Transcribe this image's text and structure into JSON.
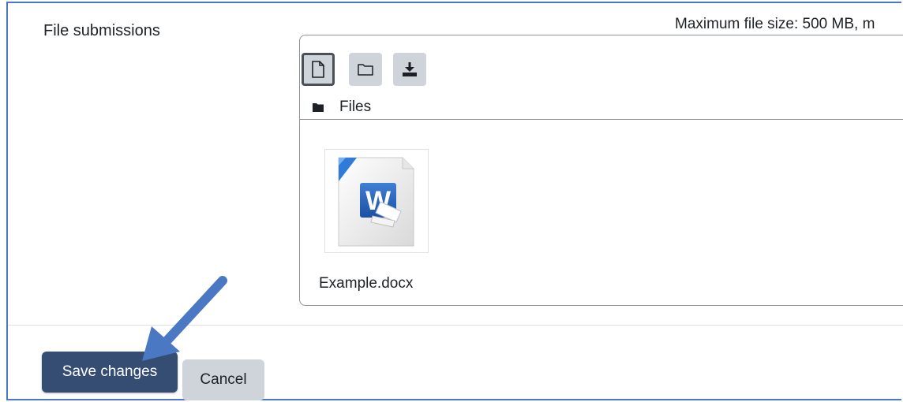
{
  "form": {
    "field_label": "File submissions",
    "max_size_text": "Maximum file size: 500 MB, m"
  },
  "file_manager": {
    "toolbar": {
      "add_file_icon": "file-icon",
      "create_folder_icon": "folder-icon",
      "download_icon": "download-icon"
    },
    "path": {
      "icon": "folder-filled-icon",
      "label": "Files"
    },
    "files": [
      {
        "name": "Example.docx",
        "icon": "word-document-icon"
      }
    ]
  },
  "actions": {
    "save_label": "Save changes",
    "cancel_label": "Cancel"
  },
  "annotation": {
    "arrow_icon": "pointer-arrow-icon",
    "arrow_color": "#4a78c2"
  },
  "colors": {
    "primary_button": "#364d73",
    "secondary_button": "#ced4da",
    "frame": "#4a78c2"
  }
}
